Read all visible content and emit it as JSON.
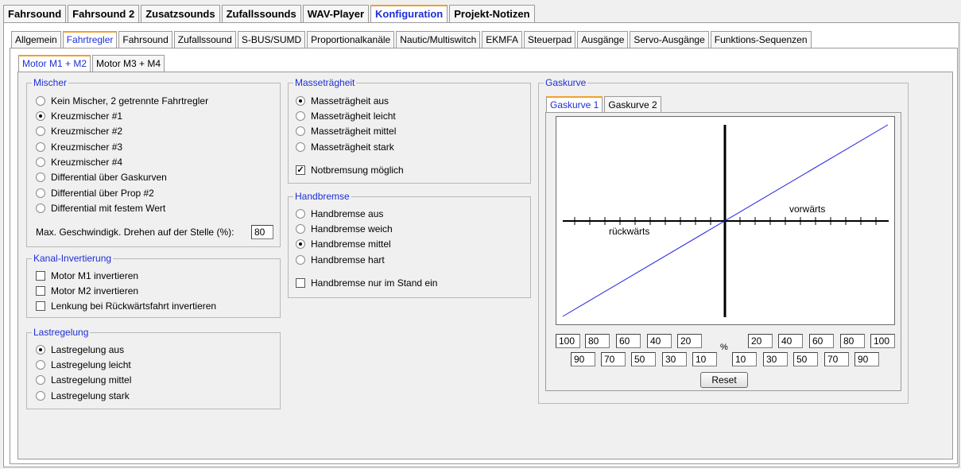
{
  "top_tabs": [
    "Fahrsound",
    "Fahrsound 2",
    "Zusatzsounds",
    "Zufallssounds",
    "WAV-Player",
    "Konfiguration",
    "Projekt-Notizen"
  ],
  "sub_tabs": [
    "Allgemein",
    "Fahrtregler",
    "Fahrsound",
    "Zufallssound",
    "S-BUS/SUMD",
    "Proportionalkanäle",
    "Nautic/Multiswitch",
    "EKMFA",
    "Steuerpad",
    "Ausgänge",
    "Servo-Ausgänge",
    "Funktions-Sequenzen"
  ],
  "motor_tabs": [
    "Motor M1 + M2",
    "Motor M3 + M4"
  ],
  "mischer": {
    "title": "Mischer",
    "options": [
      {
        "label": "Kein Mischer, 2 getrennte Fahrtregler",
        "selected": false
      },
      {
        "label": "Kreuzmischer #1",
        "selected": true
      },
      {
        "label": "Kreuzmischer #2",
        "selected": false
      },
      {
        "label": "Kreuzmischer #3",
        "selected": false
      },
      {
        "label": "Kreuzmischer #4",
        "selected": false
      },
      {
        "label": "Differential über Gaskurven",
        "selected": false
      },
      {
        "label": "Differential über Prop #2",
        "selected": false
      },
      {
        "label": "Differential mit festem Wert",
        "selected": false
      }
    ],
    "speed_label": "Max. Geschwindigk. Drehen auf der Stelle (%):",
    "speed_value": "80"
  },
  "kanal": {
    "title": "Kanal-Invertierung",
    "options": [
      {
        "label": "Motor M1 invertieren",
        "checked": false
      },
      {
        "label": "Motor M2 invertieren",
        "checked": false
      },
      {
        "label": "Lenkung bei Rückwärtsfahrt invertieren",
        "checked": false
      }
    ]
  },
  "last": {
    "title": "Lastregelung",
    "options": [
      {
        "label": "Lastregelung aus",
        "selected": true
      },
      {
        "label": "Lastregelung leicht",
        "selected": false
      },
      {
        "label": "Lastregelung mittel",
        "selected": false
      },
      {
        "label": "Lastregelung stark",
        "selected": false
      }
    ]
  },
  "masse": {
    "title": "Masseträgheit",
    "options": [
      {
        "label": "Masseträgheit aus",
        "selected": true
      },
      {
        "label": "Masseträgheit leicht",
        "selected": false
      },
      {
        "label": "Masseträgheit mittel",
        "selected": false
      },
      {
        "label": "Masseträgheit stark",
        "selected": false
      }
    ],
    "notbremse_label": "Notbremsung möglich",
    "notbremse_checked": true
  },
  "hand": {
    "title": "Handbremse",
    "options": [
      {
        "label": "Handbremse aus",
        "selected": false
      },
      {
        "label": "Handbremse weich",
        "selected": false
      },
      {
        "label": "Handbremse mittel",
        "selected": true
      },
      {
        "label": "Handbremse hart",
        "selected": false
      }
    ],
    "stand_label": "Handbremse nur im Stand ein",
    "stand_checked": false
  },
  "gas": {
    "title": "Gaskurve",
    "tabs": [
      "Gaskurve 1",
      "Gaskurve 2"
    ],
    "label_forward": "vorwärts",
    "label_backward": "rückwärts",
    "row1_left": [
      "100",
      "80",
      "60",
      "40",
      "20"
    ],
    "percent": "%",
    "row1_right": [
      "20",
      "40",
      "60",
      "80",
      "100"
    ],
    "row2_left": [
      "90",
      "70",
      "50",
      "30",
      "10"
    ],
    "row2_right": [
      "10",
      "30",
      "50",
      "70",
      "90"
    ],
    "reset_label": "Reset",
    "line_color": "#2020e0"
  }
}
